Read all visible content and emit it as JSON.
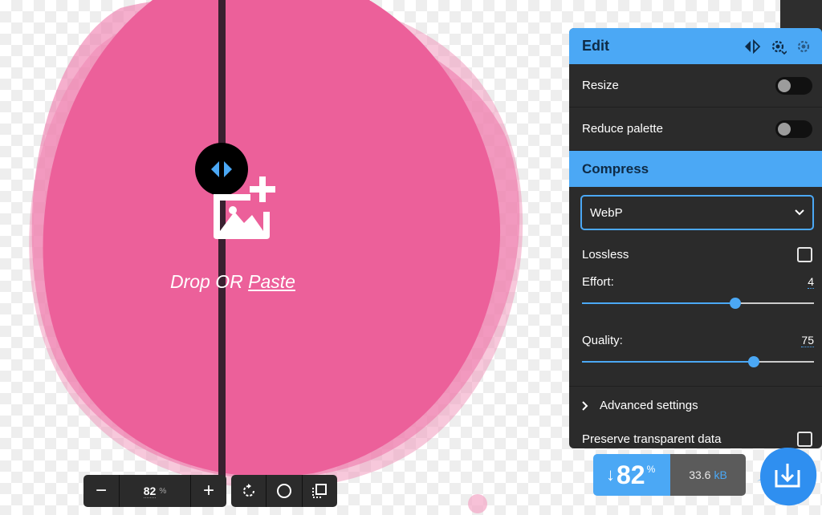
{
  "colors": {
    "accent": "#4ba8f5",
    "panel": "#2b2b2b",
    "blob": "#ec609a"
  },
  "drop": {
    "prefix": "Drop OR ",
    "link": "Paste",
    "icon": "image-add-icon"
  },
  "edit_panel": {
    "title": "Edit",
    "icons": [
      "compare-arrows-icon",
      "save-settings-icon",
      "import-settings-icon"
    ],
    "resize_label": "Resize",
    "resize_on": false,
    "reduce_palette_label": "Reduce palette",
    "reduce_palette_on": false
  },
  "compress_panel": {
    "title": "Compress",
    "format_selected": "WebP",
    "lossless_label": "Lossless",
    "lossless_checked": false,
    "effort_label": "Effort:",
    "effort_value": "4",
    "effort_fraction": 0.66,
    "quality_label": "Quality:",
    "quality_value": "75",
    "quality_fraction": 0.74,
    "advanced_label": "Advanced settings",
    "preserve_label": "Preserve transparent data",
    "preserve_checked": false
  },
  "result": {
    "arrow": "↓",
    "percent": "82",
    "percent_unit": "%",
    "size_value": "33.6",
    "size_unit": "kB"
  },
  "zoom": {
    "minus": "−",
    "value": "82",
    "unit": "%",
    "plus": "+"
  },
  "tools": [
    "rotate-icon",
    "circle-background-icon",
    "crop-frame-icon"
  ]
}
